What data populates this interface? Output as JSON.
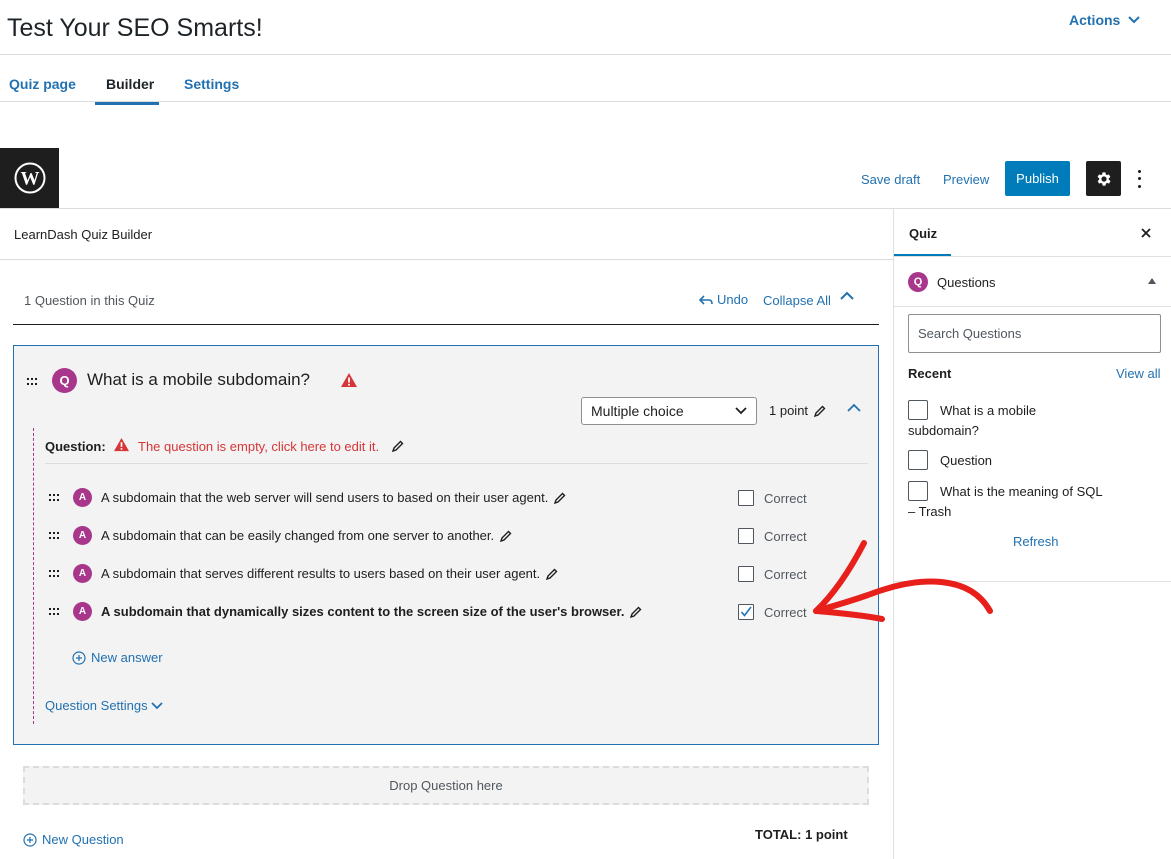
{
  "header": {
    "title": "Test Your SEO Smarts!",
    "actions_label": "Actions"
  },
  "tabs": [
    {
      "label": "Quiz page"
    },
    {
      "label": "Builder"
    },
    {
      "label": "Settings"
    }
  ],
  "toolbar": {
    "save_draft": "Save draft",
    "preview": "Preview",
    "publish": "Publish"
  },
  "builder": {
    "title": "LearnDash Quiz Builder",
    "count_text": "1 Question in this Quiz",
    "undo": "Undo",
    "collapse_all": "Collapse All"
  },
  "question": {
    "badge": "Q",
    "title": "What is a mobile subdomain?",
    "type": "Multiple choice",
    "points": "1 point",
    "question_label": "Question:",
    "question_error": "The question is empty, click here to edit it.",
    "answers": [
      {
        "badge": "A",
        "text": "A subdomain that the web server will send users to based on their user agent.",
        "correct_label": "Correct",
        "checked": false
      },
      {
        "badge": "A",
        "text": "A subdomain that can be easily changed from one server to another.",
        "correct_label": "Correct",
        "checked": false
      },
      {
        "badge": "A",
        "text": "A subdomain that serves different results to users based on their user agent.",
        "correct_label": "Correct",
        "checked": false
      },
      {
        "badge": "A",
        "text": "A subdomain that dynamically sizes content to the screen size of the user's browser.",
        "correct_label": "Correct",
        "checked": true
      }
    ],
    "new_answer": "New answer",
    "settings": "Question Settings"
  },
  "drop_zone": "Drop Question here",
  "new_question": "New Question",
  "total": "TOTAL: 1 point",
  "sidebar": {
    "tab": "Quiz",
    "section_badge": "Q",
    "section_title": "Questions",
    "search_placeholder": "Search Questions",
    "recent_label": "Recent",
    "view_all": "View all",
    "recent_items": [
      {
        "line1": "What is a mobile",
        "line2": "subdomain?"
      },
      {
        "line1": "Question",
        "line2": ""
      },
      {
        "line1": "What is the meaning of SQL",
        "line2": "– Trash"
      }
    ],
    "refresh": "Refresh"
  },
  "colors": {
    "accent": "#2271b1",
    "badge": "#a8378b",
    "error": "#d63638",
    "annotation_arrow": "#e8201c"
  }
}
